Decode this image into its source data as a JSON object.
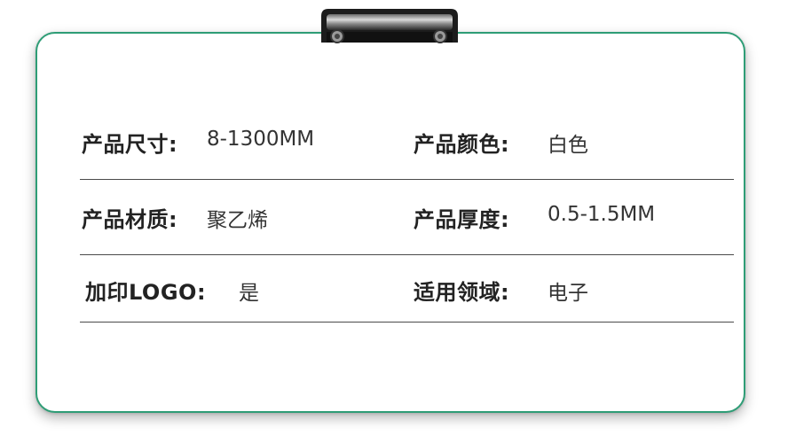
{
  "specs": [
    [
      {
        "label": "产品尺寸:",
        "value": "8-1300MM"
      },
      {
        "label": "产品颜色:",
        "value": "白色"
      }
    ],
    [
      {
        "label": "产品材质:",
        "value": "聚乙烯"
      },
      {
        "label": "产品厚度:",
        "value": "0.5-1.5MM"
      }
    ],
    [
      {
        "label": "加印LOGO:",
        "value": "是"
      },
      {
        "label": "适用领域:",
        "value": "电子"
      }
    ]
  ],
  "colors": {
    "border": "#2e9d76",
    "divider": "#4a4a4a",
    "label": "#222222",
    "value": "#333333"
  },
  "icons": {
    "clip": "clipboard-clip-icon"
  }
}
